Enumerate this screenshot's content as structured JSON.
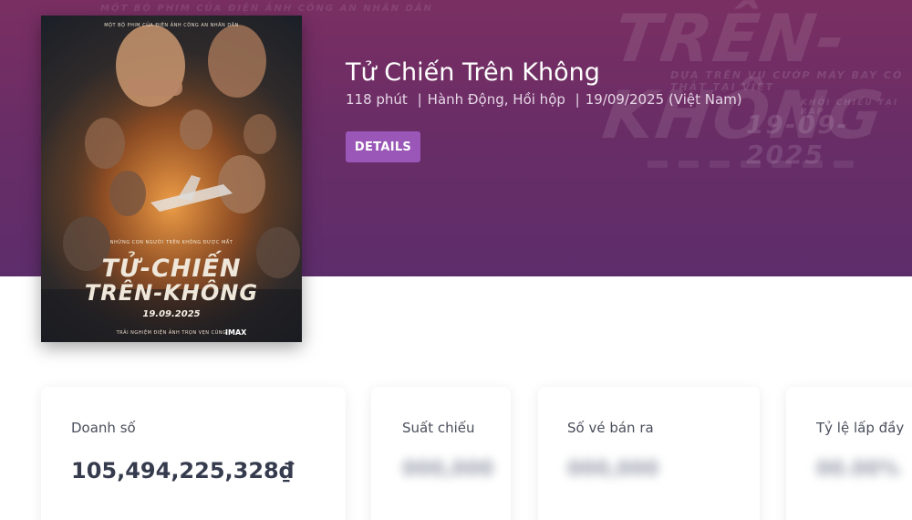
{
  "hero": {
    "background_title": "TRÊN-KHÔNG",
    "background_tagline": "DỰA TRÊN VỤ CƯỚP MÁY BAY CÓ THẬT TẠI VIỆT",
    "background_date_caption": "KHỞI CHIẾU TẠI RẠP",
    "background_date": "19-09-2025",
    "background_top": "MỘT BỘ PHIM CỦA ĐIỆN ẢNH CÔNG AN NHÂN DÂN"
  },
  "poster": {
    "top_text": "MỘT BỘ PHIM CỦA ĐIỆN ẢNH CÔNG AN NHÂN DÂN",
    "tagline": "NHỮNG CON NGƯỜI TRÊN KHÔNG ĐƯỢC MẤT",
    "title_line1": "TỬ-CHIẾN",
    "title_line2": "TRÊN-KHÔNG",
    "date": "19.09.2025",
    "bottom_text": "TRẢI NGHIỆM ĐIỆN ẢNH TRỌN VẸN CÙNG",
    "imax": "IMAX"
  },
  "movie": {
    "title": "Tử Chiến Trên Không",
    "duration": "118 phút",
    "separator": "|",
    "genres": "Hành Động, Hồi hộp",
    "release": "19/09/2025 (Việt Nam)",
    "details_label": "DETAILS"
  },
  "stats": [
    {
      "label": "Doanh số",
      "value": "105,494,225,328₫"
    },
    {
      "label": "Suất chiếu",
      "value": "000,000"
    },
    {
      "label": "Số vé bán ra",
      "value": "000,000"
    },
    {
      "label": "Tỷ lệ lấp đầy",
      "value": "00.00%"
    }
  ],
  "colors": {
    "hero_bg": "#6a2d66",
    "button": "#9a57b8",
    "value_text": "#363c4e"
  }
}
